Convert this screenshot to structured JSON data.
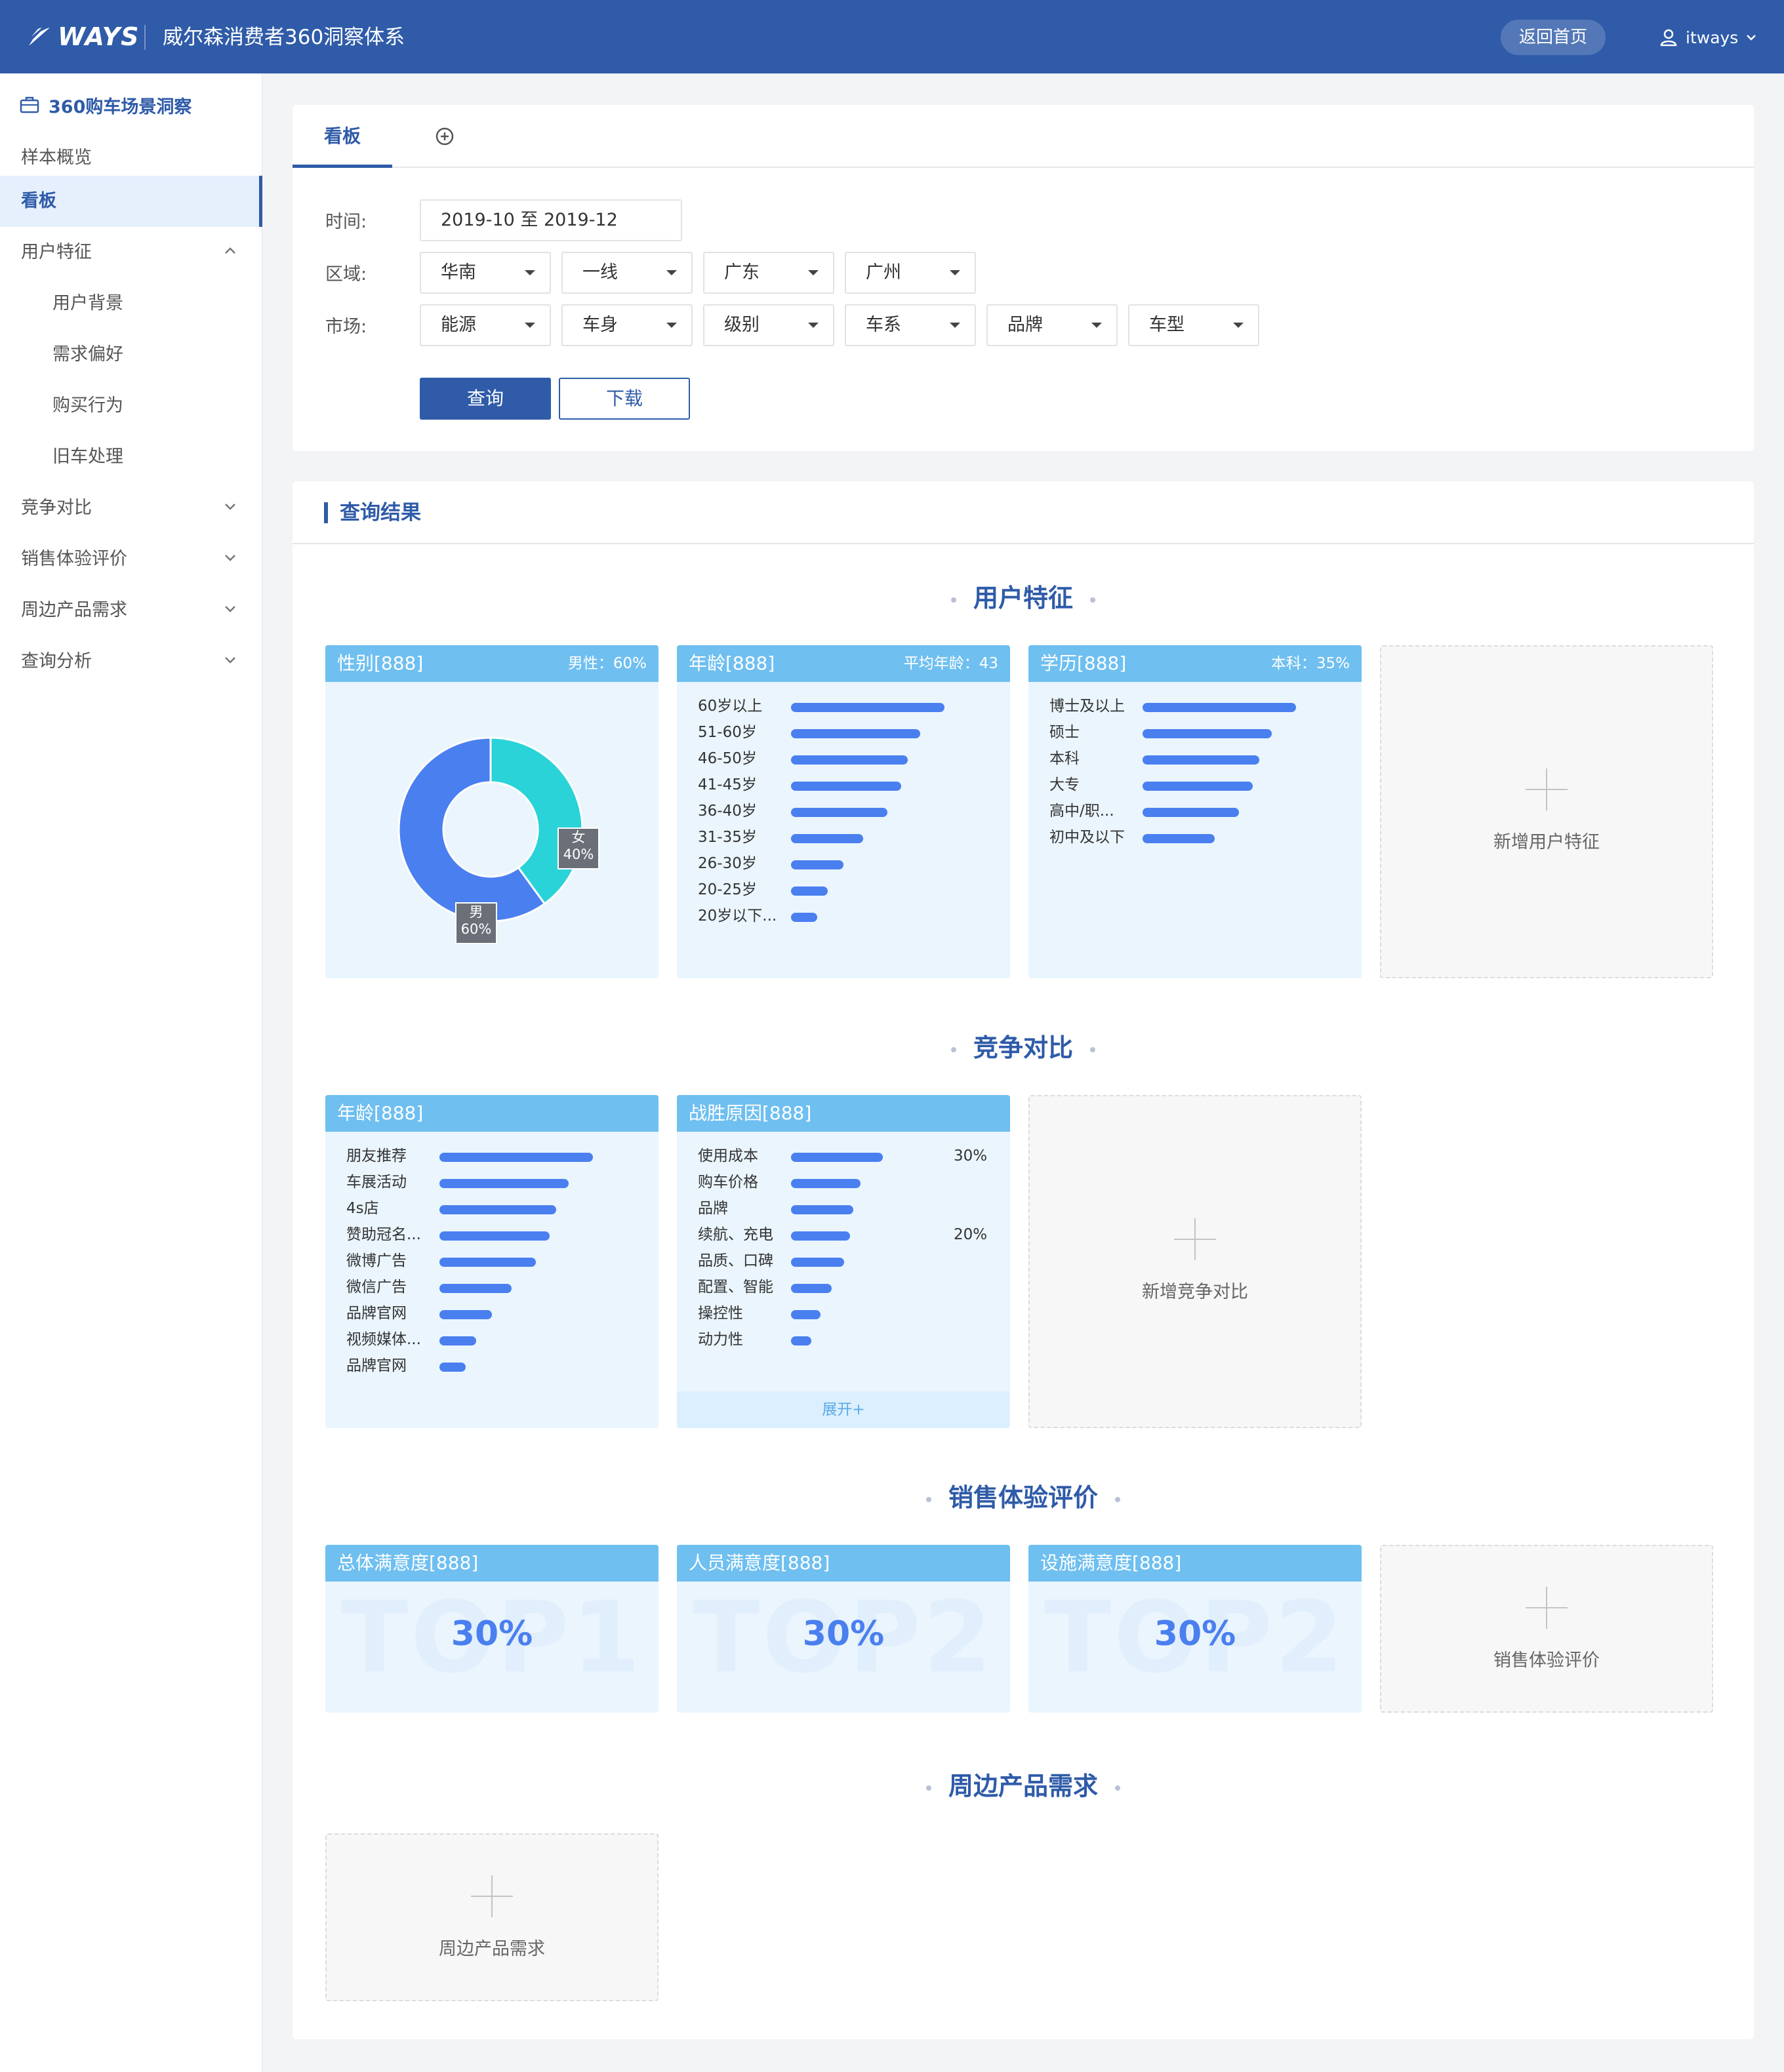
{
  "header": {
    "logo": "WAYS",
    "title": "威尔森消费者360洞察体系",
    "home_button": "返回首页",
    "user": "itways"
  },
  "sidebar": {
    "section": "360购车场景洞察",
    "items": [
      {
        "label": "样本概览"
      },
      {
        "label": "看板"
      },
      {
        "label": "用户特征"
      },
      {
        "label": "用户背景"
      },
      {
        "label": "需求偏好"
      },
      {
        "label": "购买行为"
      },
      {
        "label": "旧车处理"
      },
      {
        "label": "竞争对比"
      },
      {
        "label": "销售体验评价"
      },
      {
        "label": "周边产品需求"
      },
      {
        "label": "查询分析"
      }
    ]
  },
  "tabs": {
    "active": "看板"
  },
  "filters": {
    "time_label": "时间:",
    "time_value": "2019-10 至 2019-12",
    "region_label": "区域:",
    "region": [
      "华南",
      "一线",
      "广东",
      "广州"
    ],
    "market_label": "市场:",
    "market": [
      "能源",
      "车身",
      "级别",
      "车系",
      "品牌",
      "车型"
    ],
    "query_button": "查询",
    "download_button": "下载"
  },
  "results": {
    "title": "查询结果",
    "sections": {
      "user": "用户特征",
      "competition": "竞争对比",
      "sales": "销售体验评价",
      "peripheral": "周边产品需求"
    }
  },
  "gender_card": {
    "title": "性别[888]",
    "meta": "男性：60%",
    "female_label": "女",
    "female_pct": "40%",
    "male_label": "男",
    "male_pct": "60%",
    "colors": {
      "male": "#4a7ff0",
      "female": "#2ad3d8"
    }
  },
  "age_card": {
    "title": "年龄[888]",
    "meta": "平均年龄：43",
    "rows": [
      {
        "label": "60岁以上",
        "value": 1.0
      },
      {
        "label": "51-60岁",
        "value": 0.84
      },
      {
        "label": "46-50岁",
        "value": 0.76
      },
      {
        "label": "41-45岁",
        "value": 0.72
      },
      {
        "label": "36-40岁",
        "value": 0.63
      },
      {
        "label": "31-35岁",
        "value": 0.47
      },
      {
        "label": "26-30岁",
        "value": 0.34
      },
      {
        "label": "20-25岁",
        "value": 0.24
      },
      {
        "label": "20岁以下...",
        "value": 0.17
      }
    ]
  },
  "edu_card": {
    "title": "学历[888]",
    "meta": "本科：35%",
    "rows": [
      {
        "label": "博士及以上",
        "value": 1.0
      },
      {
        "label": "硕士",
        "value": 0.84
      },
      {
        "label": "本科",
        "value": 0.76
      },
      {
        "label": "大专",
        "value": 0.72
      },
      {
        "label": "高中/职...",
        "value": 0.63
      },
      {
        "label": "初中及以下",
        "value": 0.47
      }
    ]
  },
  "add_user": "新增用户特征",
  "channel_card": {
    "title": "年龄[888]",
    "rows": [
      {
        "label": "朋友推荐",
        "value": 1.0
      },
      {
        "label": "车展活动",
        "value": 0.84
      },
      {
        "label": "4s店",
        "value": 0.76
      },
      {
        "label": "赞助冠名...",
        "value": 0.72
      },
      {
        "label": "微博广告",
        "value": 0.63
      },
      {
        "label": "微信广告",
        "value": 0.47
      },
      {
        "label": "品牌官网",
        "value": 0.34
      },
      {
        "label": "视频媒体...",
        "value": 0.24
      },
      {
        "label": "品牌官网",
        "value": 0.17
      }
    ]
  },
  "reason_card": {
    "title": "战胜原因[888]",
    "rows": [
      {
        "label": "使用成本",
        "value": 1.0,
        "pct": "30%"
      },
      {
        "label": "购车价格",
        "value": 0.76,
        "pct": ""
      },
      {
        "label": "品牌",
        "value": 0.68,
        "pct": ""
      },
      {
        "label": "续航、充电",
        "value": 0.64,
        "pct": "20%"
      },
      {
        "label": "品质、口碑",
        "value": 0.58,
        "pct": ""
      },
      {
        "label": "配置、智能",
        "value": 0.44,
        "pct": ""
      },
      {
        "label": "操控性",
        "value": 0.32,
        "pct": ""
      },
      {
        "label": "动力性",
        "value": 0.22,
        "pct": ""
      }
    ],
    "expand": "展开+"
  },
  "add_competition": "新增竞争对比",
  "satisfaction": [
    {
      "title": "总体满意度[888]",
      "bg": "TOP1",
      "value": "30%"
    },
    {
      "title": "人员满意度[888]",
      "bg": "TOP2",
      "value": "30%"
    },
    {
      "title": "设施满意度[888]",
      "bg": "TOP2",
      "value": "30%"
    }
  ],
  "add_sales": "销售体验评价",
  "add_peripheral": "周边产品需求"
}
